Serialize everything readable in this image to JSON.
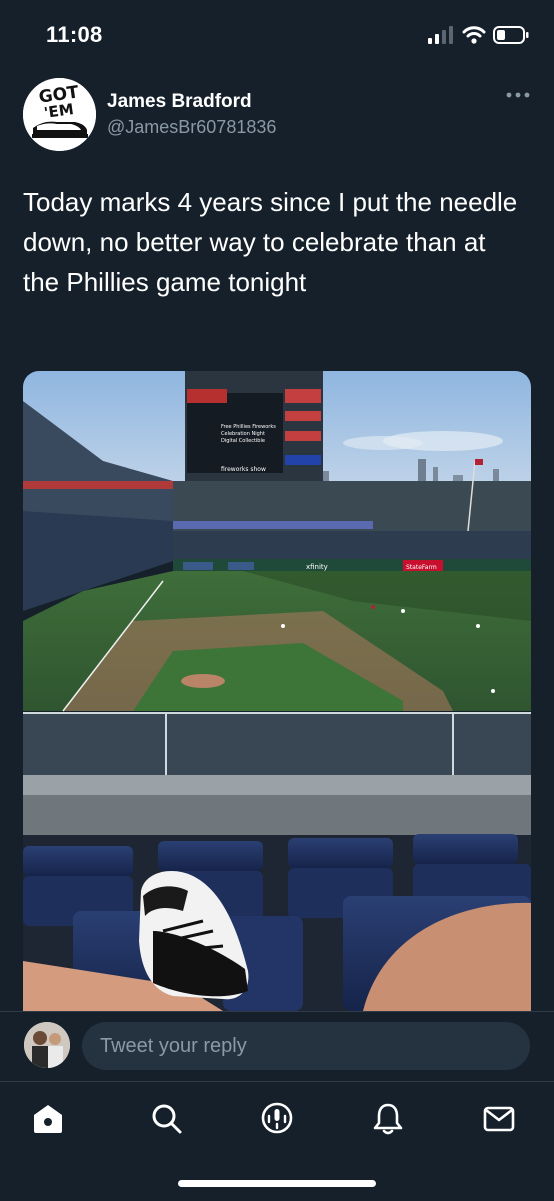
{
  "status_bar": {
    "time": "11:08",
    "icons": [
      "signal-icon",
      "wifi-icon",
      "battery-icon"
    ]
  },
  "tweet": {
    "author_name": "James Bradford",
    "author_handle": "@JamesBr60781836",
    "avatar_text_line1": "GOT",
    "avatar_text_line2": "'EM",
    "text": "Today marks 4 years since I put the needle down, no better way to celebrate than at the Phillies game tonight",
    "media": {
      "description_icon": "photo",
      "scoreboard_lines": [
        "Free Phillies Fireworks",
        "Celebration Night",
        "Digital Collectible"
      ],
      "scoreboard_footer": "fireworks show",
      "ad_labels": [
        "xfinity",
        "StateFarm"
      ]
    }
  },
  "reply": {
    "placeholder": "Tweet your reply"
  },
  "tab_bar": {
    "items": [
      "home-icon",
      "search-icon",
      "spaces-icon",
      "notifications-icon",
      "messages-icon"
    ]
  },
  "colors": {
    "background": "#15202b",
    "text_primary": "#ffffff",
    "text_secondary": "#8b98a5",
    "input_bg": "#253341"
  }
}
